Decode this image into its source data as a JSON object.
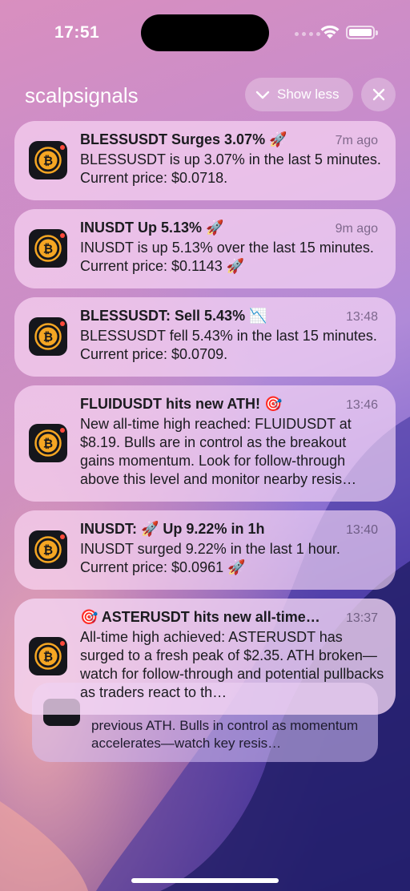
{
  "status_bar": {
    "time": "17:51"
  },
  "group": {
    "app_name": "scalpsignals",
    "show_less_label": "Show less"
  },
  "notifications": [
    {
      "title": "BLESSUSDT Surges 3.07% 🚀",
      "time": "7m ago",
      "body": "BLESSUSDT is up 3.07% in the last 5 minutes. Current price: $0.0718."
    },
    {
      "title": "INUSDT Up 5.13% 🚀",
      "time": "9m ago",
      "body": "INUSDT is up 5.13% over the last 15 minutes. Current price: $0.1143 🚀"
    },
    {
      "title": "BLESSUSDT: Sell 5.43% 📉",
      "time": "13:48",
      "body": "BLESSUSDT fell 5.43% in the last 15 minutes. Current price: $0.0709."
    },
    {
      "title": "FLUIDUSDT hits new ATH! 🎯",
      "time": "13:46",
      "body": "New all-time high reached: FLUIDUSDT at $8.19. Bulls are in control as the breakout gains momentum. Look for follow-through above this level and monitor nearby resis…"
    },
    {
      "title": "INUSDT: 🚀 Up 9.22% in 1h",
      "time": "13:40",
      "body": "INUSDT surged 9.22% in the last 1 hour. Current price: $0.0961 🚀"
    },
    {
      "title": "🎯 ASTERUSDT hits new all-time…",
      "time": "13:37",
      "body": "All-time high achieved: ASTERUSDT has surged to a fresh peak of $2.35. ATH broken—watch for follow-through and potential pullbacks as traders react to th…"
    }
  ],
  "stacked": {
    "body": "previous ATH. Bulls in control as momentum accelerates—watch key resis…"
  },
  "icons": {
    "app": "bitcoin-coin-icon",
    "badge": "red-dot-badge"
  },
  "colors": {
    "coin": "#f5a623",
    "badge": "#ff4a3d"
  }
}
